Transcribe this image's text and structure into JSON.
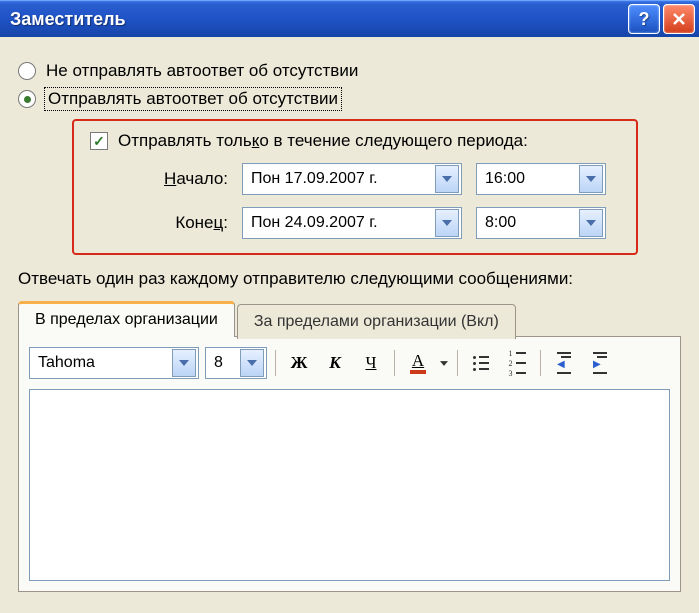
{
  "window": {
    "title": "Заместитель"
  },
  "radios": {
    "no_send": "Не отправлять автоответ об отсутствии",
    "send": "Отправлять автоответ об отсутствии"
  },
  "period": {
    "checkbox_label": "Отправлять только в течение следующего периода:",
    "start_label": "Начало:",
    "end_label": "Конец:",
    "start_date": "Пон 17.09.2007 г.",
    "start_time": "16:00",
    "end_date": "Пон 24.09.2007 г.",
    "end_time": "8:00"
  },
  "reply_line": "Отвечать один раз каждому отправителю следующими сообщениями:",
  "tabs": {
    "inside": "В пределах организации",
    "outside": "За пределами организации (Вкл)"
  },
  "toolbar": {
    "font": "Tahoma",
    "size": "8",
    "bold": "Ж",
    "italic": "К",
    "underline": "Ч",
    "fontcolor": "А"
  }
}
